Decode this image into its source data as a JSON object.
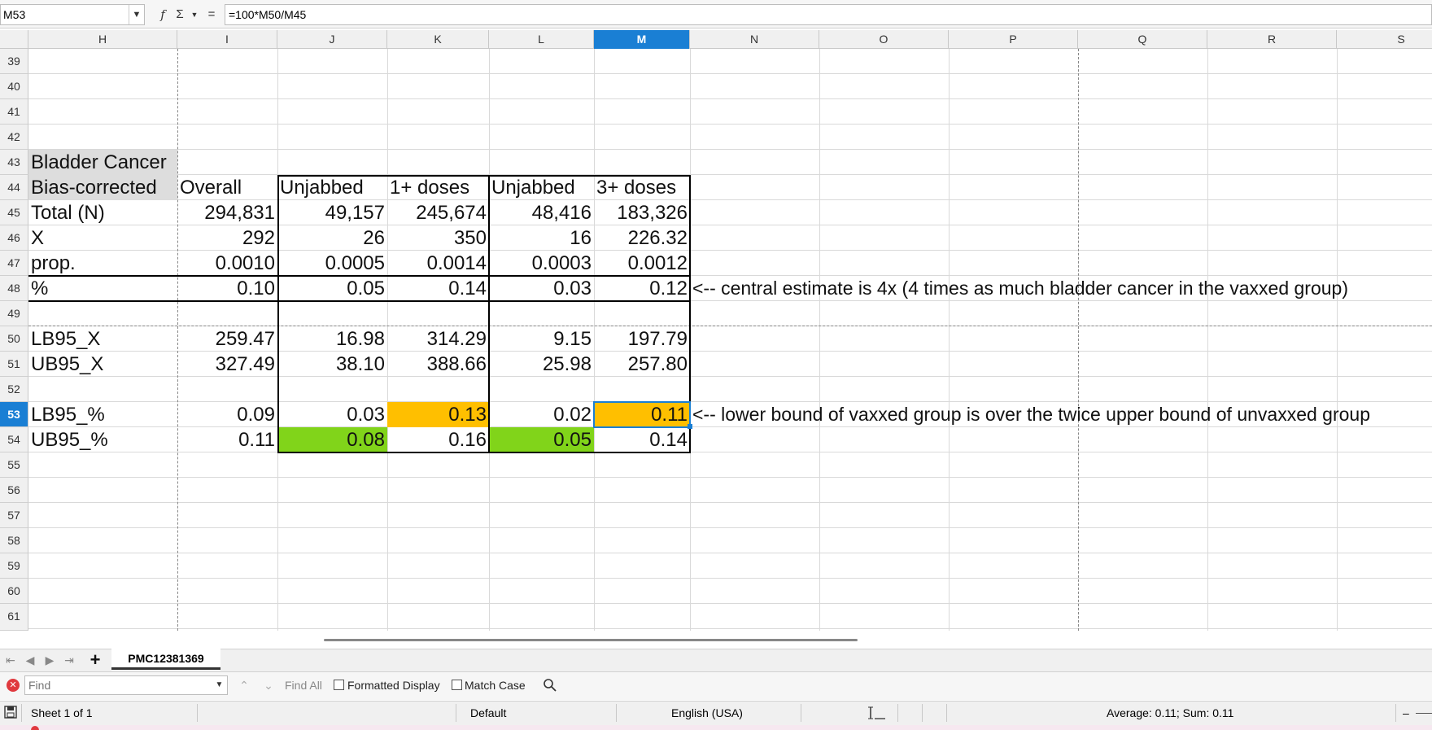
{
  "formula_bar": {
    "name_box": "M53",
    "fx": "f",
    "sum": "Σ",
    "equals": "=",
    "formula": "=100*M50/M45"
  },
  "columns": [
    "H",
    "I",
    "J",
    "K",
    "L",
    "M",
    "N",
    "O",
    "P",
    "Q",
    "R",
    "S"
  ],
  "selected_column": "M",
  "rows": [
    "39",
    "40",
    "41",
    "42",
    "43",
    "44",
    "45",
    "46",
    "47",
    "48",
    "49",
    "50",
    "51",
    "52",
    "53",
    "54",
    "55",
    "56",
    "57",
    "58",
    "59",
    "60",
    "61"
  ],
  "selected_row": "53",
  "table": {
    "title": "Bladder Cancer",
    "subtitle": "Bias-corrected",
    "headers": [
      "Overall",
      "Unjabbed",
      "1+ doses",
      "Unjabbed",
      "3+ doses"
    ],
    "data_rows": [
      {
        "label": "Total (N)",
        "values": [
          "294,831",
          "49,157",
          "245,674",
          "48,416",
          "183,326"
        ]
      },
      {
        "label": "X",
        "values": [
          "292",
          "26",
          "350",
          "16",
          "226.32"
        ]
      },
      {
        "label": "prop.",
        "values": [
          "0.0010",
          "0.0005",
          "0.0014",
          "0.0003",
          "0.0012"
        ]
      },
      {
        "label": "%",
        "values": [
          "0.10",
          "0.05",
          "0.14",
          "0.03",
          "0.12"
        ]
      },
      {
        "label": "LB95_X",
        "values": [
          "259.47",
          "16.98",
          "314.29",
          "9.15",
          "197.79"
        ]
      },
      {
        "label": "UB95_X",
        "values": [
          "327.49",
          "38.10",
          "388.66",
          "25.98",
          "257.80"
        ]
      },
      {
        "label": "LB95_%",
        "values": [
          "0.09",
          "0.03",
          "0.13",
          "0.02",
          "0.11"
        ]
      },
      {
        "label": "UB95_%",
        "values": [
          "0.11",
          "0.08",
          "0.16",
          "0.05",
          "0.14"
        ]
      }
    ],
    "note_row48": "<-- central estimate is 4x (4 times as much bladder cancer in the vaxxed group)",
    "note_row53": "<-- lower bound of vaxxed group is over the twice upper bound of unvaxxed group"
  },
  "colors": {
    "orange_highlight": "#ffbf00",
    "green_highlight": "#81d41a",
    "title_bg": "#dddddd",
    "selection": "#1a7fd4"
  },
  "sheet_tabs": {
    "add": "+",
    "active": "PMC12381369"
  },
  "find_bar": {
    "placeholder": "Find",
    "find_all": "Find All",
    "formatted_display": "Formatted Display",
    "match_case": "Match Case"
  },
  "status_bar": {
    "sheet": "Sheet 1 of 1",
    "style": "Default",
    "language": "English (USA)",
    "summary": "Average: 0.11; Sum: 0.11",
    "zoom_minus": "–"
  }
}
